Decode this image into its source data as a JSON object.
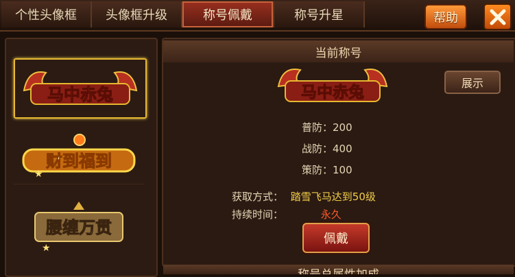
{
  "tabs": [
    {
      "label": "个性头像框"
    },
    {
      "label": "头像框升级"
    },
    {
      "label": "称号佩戴"
    },
    {
      "label": "称号升星"
    }
  ],
  "help_label": "帮助",
  "close_icon": "x-close-icon",
  "titles_list": [
    {
      "text": "马中赤兔"
    },
    {
      "text": "财到福到"
    },
    {
      "text": "腰缠万贯"
    }
  ],
  "current": {
    "header": "当前称号",
    "emblem_text": "马中赤兔",
    "show_label": "展示",
    "stats": [
      {
        "label": "普防：",
        "value": "200"
      },
      {
        "label": "战防：",
        "value": "400"
      },
      {
        "label": "策防：",
        "value": "100"
      }
    ],
    "obtain_label": "获取方式：",
    "obtain_value": "踏雪飞马达到50级",
    "duration_label": "持续时间：",
    "duration_value": "永久",
    "wear_label": "佩戴"
  },
  "bottom_header": "称号总属性加成",
  "colors": {
    "accent_gold": "#f3cf4a",
    "duration_red": "#ff5a2a",
    "active_tab": "#9a3020"
  }
}
